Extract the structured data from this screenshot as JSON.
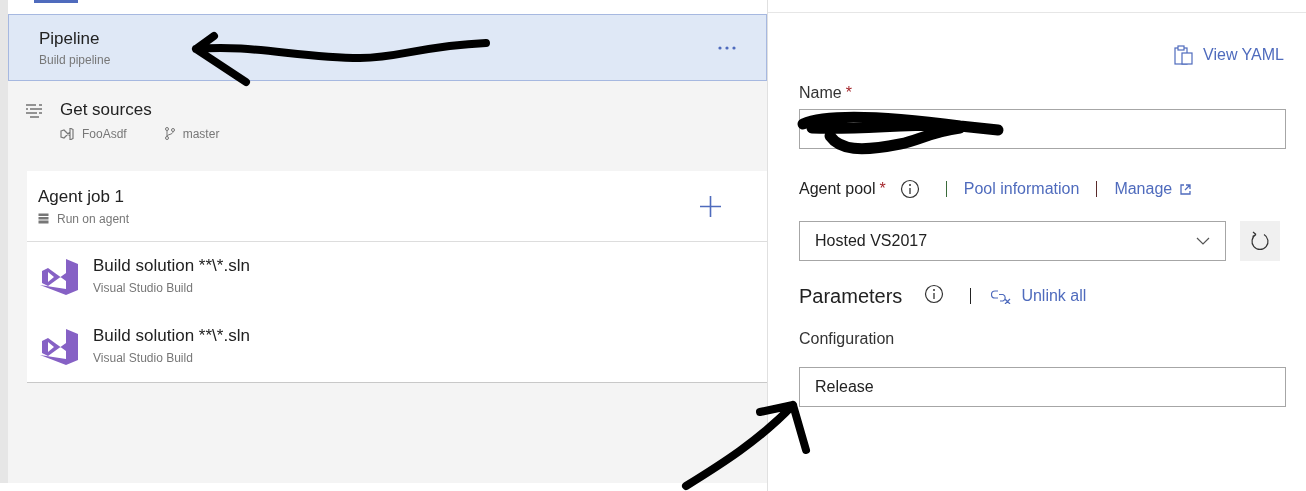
{
  "pipeline": {
    "title": "Pipeline",
    "subtitle": "Build pipeline",
    "selected": true
  },
  "get_sources": {
    "title": "Get sources",
    "repository": "FooAsdf",
    "branch": "master"
  },
  "agent_job": {
    "title": "Agent job 1",
    "subtitle": "Run on agent"
  },
  "tasks": [
    {
      "title": "Build solution **\\*.sln",
      "subtitle": "Visual Studio Build"
    },
    {
      "title": "Build solution **\\*.sln",
      "subtitle": "Visual Studio Build"
    }
  ],
  "details": {
    "view_yaml": "View YAML",
    "name": {
      "label": "Name",
      "required_mark": "*"
    },
    "agent_pool": {
      "label": "Agent pool",
      "required_mark": "*",
      "pool_information": "Pool information",
      "manage": "Manage",
      "value": "Hosted VS2017"
    },
    "parameters": {
      "title": "Parameters",
      "unlink_all": "Unlink all"
    },
    "configuration": {
      "label": "Configuration",
      "value": "Release"
    }
  }
}
